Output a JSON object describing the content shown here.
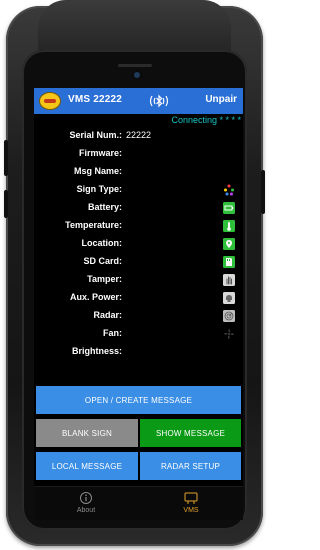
{
  "appbar": {
    "title": "VMS 22222",
    "action_label": "Unpair",
    "bluetooth_icon": "bluetooth-icon"
  },
  "status": {
    "text": "Connecting * * * *",
    "color": "#19c5c5"
  },
  "info_rows": [
    {
      "label": "Serial Num.:",
      "value": "22222",
      "icon": ""
    },
    {
      "label": "Firmware:",
      "value": "",
      "icon": ""
    },
    {
      "label": "Msg Name:",
      "value": "",
      "icon": ""
    },
    {
      "label": "Sign Type:",
      "value": "",
      "icon": "color-dots-icon"
    },
    {
      "label": "Battery:",
      "value": "",
      "icon": "battery-icon"
    },
    {
      "label": "Temperature:",
      "value": "",
      "icon": "thermometer-icon"
    },
    {
      "label": "Location:",
      "value": "",
      "icon": "location-pin-icon"
    },
    {
      "label": "SD Card:",
      "value": "",
      "icon": "sd-card-icon"
    },
    {
      "label": "Tamper:",
      "value": "",
      "icon": "hand-icon"
    },
    {
      "label": "Aux. Power:",
      "value": "",
      "icon": "plug-icon"
    },
    {
      "label": "Radar:",
      "value": "",
      "icon": "radar-icon"
    },
    {
      "label": "Fan:",
      "value": "",
      "icon": "fan-icon"
    },
    {
      "label": "Brightness:",
      "value": "",
      "icon": ""
    }
  ],
  "buttons": {
    "open_create": "OPEN / CREATE MESSAGE",
    "blank_sign": "BLANK SIGN",
    "show_message": "SHOW MESSAGE",
    "local_message": "LOCAL MESSAGE",
    "radar_setup": "RADAR SETUP"
  },
  "nav": {
    "about": "About",
    "vms": "VMS"
  },
  "colors": {
    "appbar": "#2a6fd6",
    "button_blue": "#3a8ee6",
    "button_grey": "#8a8a8a",
    "button_green": "#0b9a16",
    "nav_active": "#e3a12a",
    "icon_green": "#2fbf3a"
  }
}
